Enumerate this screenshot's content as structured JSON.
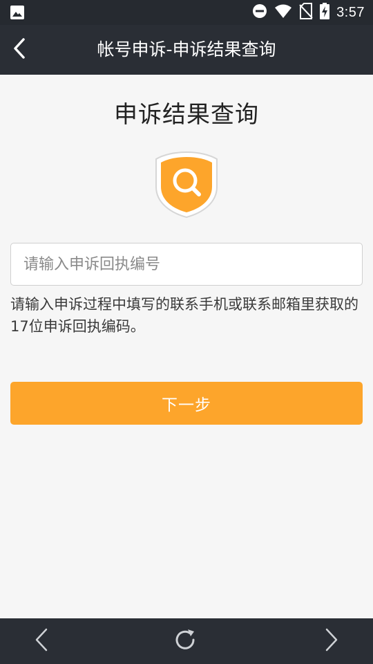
{
  "status_bar": {
    "time": "3:57",
    "icons": [
      "gallery-icon",
      "do-not-disturb-icon",
      "wifi-icon",
      "no-sim-icon",
      "battery-charging-icon"
    ]
  },
  "title_bar": {
    "title": "帐号申诉-申诉结果查询",
    "back_icon": "chevron-left-icon"
  },
  "main": {
    "heading": "申诉结果查询",
    "badge_icon": "search-shield-icon",
    "receipt_input": {
      "placeholder": "请输入申诉回执编号",
      "value": ""
    },
    "hint": "请输入申诉过程中填写的联系手机或联系邮箱里获取的17位申诉回执编码。",
    "next_button_label": "下一步"
  },
  "bottom_nav": {
    "items": [
      "back-icon",
      "refresh-icon",
      "forward-icon"
    ]
  },
  "colors": {
    "accent": "#fda52b",
    "bar_bg": "#2a2e35",
    "page_bg": "#f6f6f6"
  }
}
